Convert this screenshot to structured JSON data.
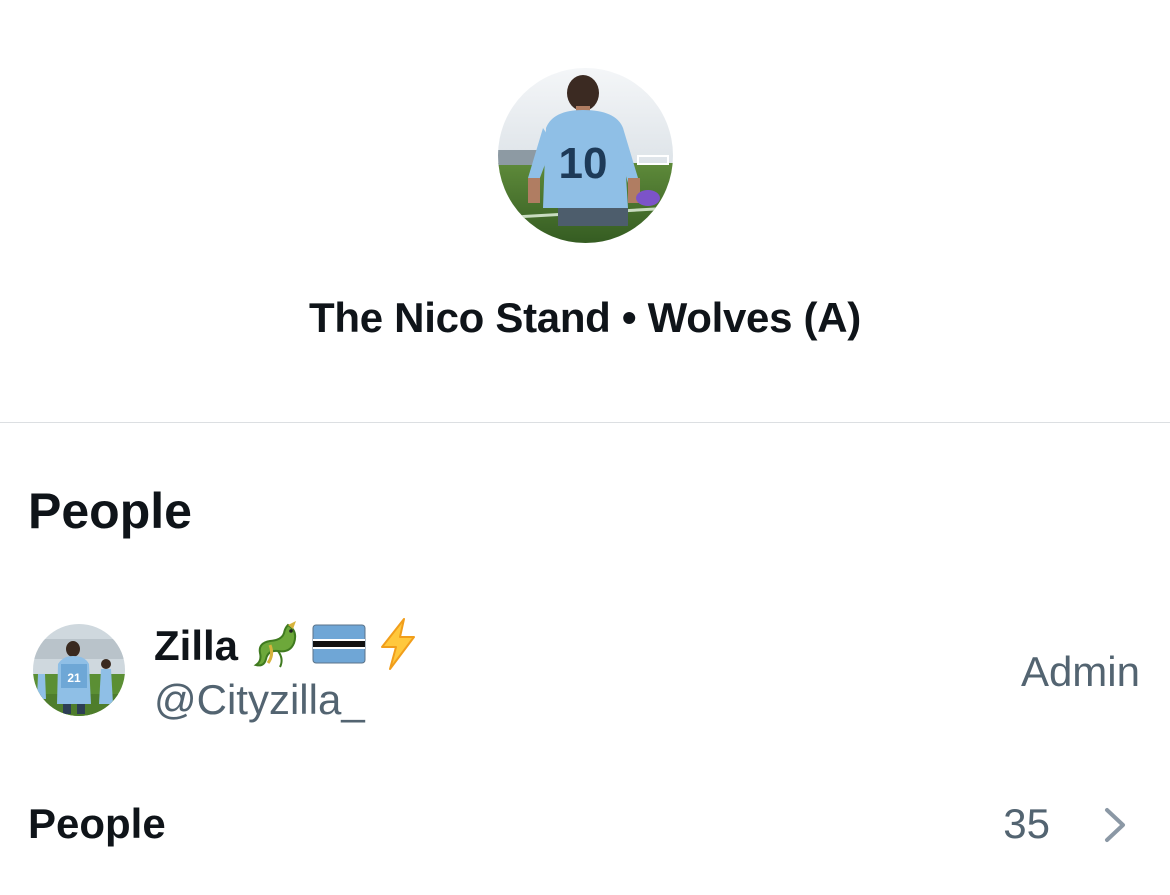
{
  "group": {
    "title": "The Nico Stand • Wolves (A)",
    "avatar_icon": "group-photo-player-10"
  },
  "people_section": {
    "heading": "People",
    "members": [
      {
        "name": "Zilla",
        "emojis": [
          "dragon-emoji",
          "botswana-flag-emoji",
          "lightning-emoji"
        ],
        "handle": "@Cityzilla_",
        "role": "Admin"
      }
    ]
  },
  "people_row": {
    "label": "People",
    "count": "35",
    "icon": "chevron-right-icon"
  },
  "colors": {
    "text_primary": "#0f1419",
    "text_secondary": "#536471",
    "divider": "#dcdfe2",
    "chevron": "#8b98a5"
  }
}
